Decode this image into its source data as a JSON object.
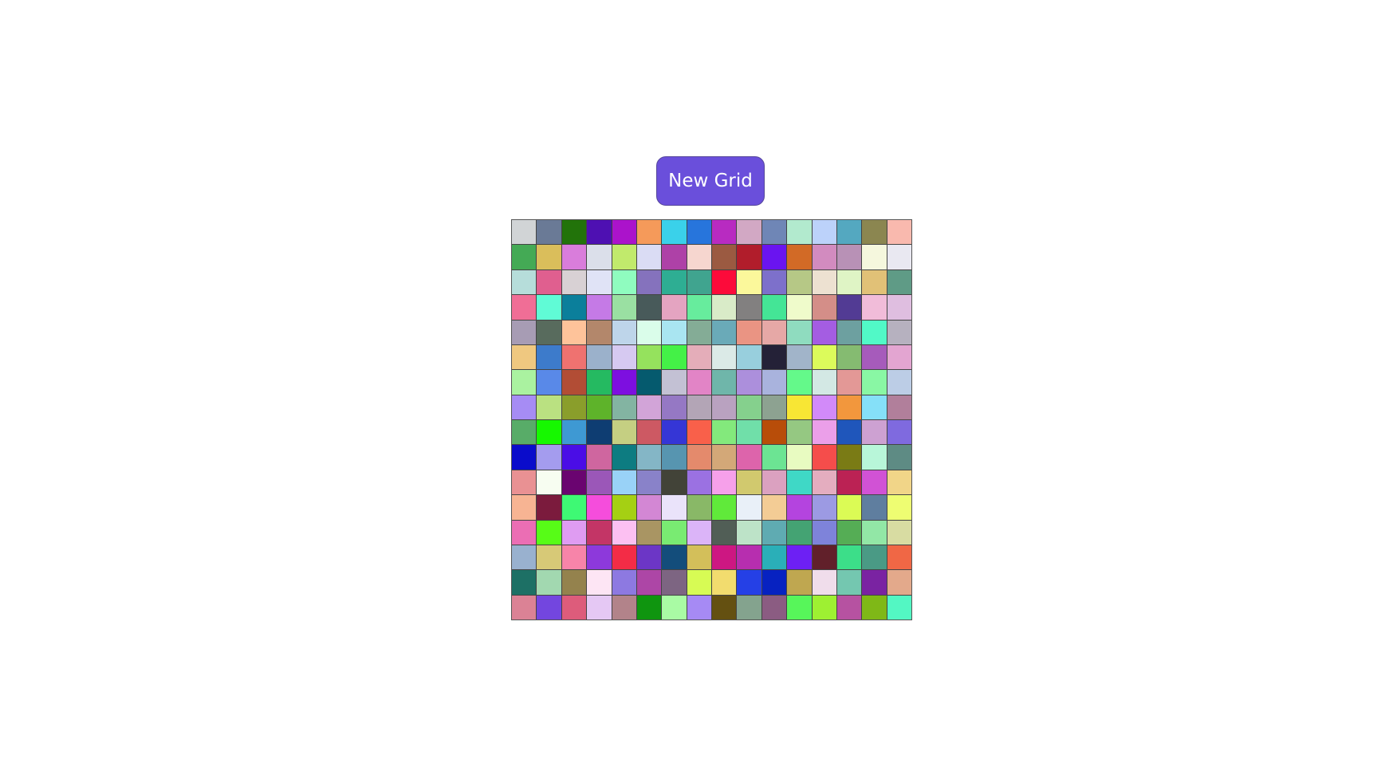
{
  "toolbar": {
    "new_grid_label": "New Grid",
    "button_color": "#6a4fdb"
  },
  "grid": {
    "columns": 16,
    "rows": 16,
    "colors": [
      [
        "#d1d4d6",
        "#6a7a96",
        "#22730a",
        "#4e10b2",
        "#ab13cb",
        "#f59a5a",
        "#3ad1ea",
        "#2775dc",
        "#b82bc1",
        "#d2a8c4",
        "#6f86b6",
        "#b2eace",
        "#bcd2fa",
        "#54a8c0",
        "#8b8650",
        "#f9b9ae"
      ],
      [
        "#44aa55",
        "#dabe5b",
        "#d97ddb",
        "#dbdfea",
        "#c1ea6c",
        "#dadcf4",
        "#ae41a7",
        "#f6d6cf",
        "#9b5a41",
        "#b11d2b",
        "#6a14f0",
        "#d26a26",
        "#d28bbf",
        "#b891b6",
        "#f5f7dd",
        "#e9e8f1"
      ],
      [
        "#b6ddda",
        "#e05f8f",
        "#d8d1d4",
        "#e0e3f6",
        "#8ffcbf",
        "#8572bd",
        "#2eae93",
        "#40a48f",
        "#fc0b3a",
        "#fbf89b",
        "#7d70cb",
        "#b6c886",
        "#ede1d1",
        "#dff4c5",
        "#e1c177",
        "#5f9b86"
      ],
      [
        "#f06e96",
        "#60fbd6",
        "#0b7f9b",
        "#c57ae6",
        "#9ae0a2",
        "#485a5a",
        "#e4a4c1",
        "#67ec9d",
        "#d9ebc8",
        "#828080",
        "#44e596",
        "#effbcb",
        "#d48e88",
        "#523b94",
        "#f1bcd9",
        "#dfbee0"
      ],
      [
        "#a79cb4",
        "#586b5d",
        "#fec39a",
        "#b3876b",
        "#bed5ea",
        "#dafdea",
        "#a9e5f1",
        "#84ac96",
        "#6aaab8",
        "#ea9483",
        "#e6a8a6",
        "#8fdcbf",
        "#a45de2",
        "#6da0a0",
        "#51f9c7",
        "#b6b1bf"
      ],
      [
        "#efc880",
        "#3d7bcb",
        "#ef7270",
        "#9bb1cb",
        "#d6c9f1",
        "#95e25d",
        "#44f147",
        "#e4adb9",
        "#dbeae7",
        "#98cfdd",
        "#242137",
        "#a1b4c9",
        "#dcfb5b",
        "#85bb71",
        "#a65bbb",
        "#e3a5d1"
      ],
      [
        "#aaf2a0",
        "#5989e8",
        "#b24d35",
        "#25ba61",
        "#7d0fe0",
        "#055a6e",
        "#c3c1d4",
        "#e284c6",
        "#6fb6aa",
        "#ac8fdc",
        "#a9b3dd",
        "#64f98a",
        "#d3e8e4",
        "#e39896",
        "#89f7a4",
        "#bccde6"
      ],
      [
        "#a68cf4",
        "#bae181",
        "#8a9e2b",
        "#5eb32a",
        "#83b4a2",
        "#d2a4d8",
        "#9578c4",
        "#b3a5b6",
        "#b9a2c0",
        "#85d08d",
        "#8da291",
        "#f8e634",
        "#d28af9",
        "#f2973d",
        "#85e0f8",
        "#b17f9b"
      ],
      [
        "#58ac68",
        "#16f800",
        "#3e99d3",
        "#0e3d72",
        "#c5cf82",
        "#cd5963",
        "#3536d6",
        "#f9604a",
        "#83e97c",
        "#70dfa9",
        "#b84d09",
        "#95c882",
        "#eb9fe9",
        "#1f56bb",
        "#cda1d2",
        "#7f6adf"
      ],
      [
        "#0a0ccb",
        "#a49cee",
        "#4a0de6",
        "#cf669f",
        "#0d7c81",
        "#84b6c6",
        "#5795b0",
        "#e48a6c",
        "#d3a878",
        "#dd64ab",
        "#6ce493",
        "#e8fbc1",
        "#f54d4b",
        "#7a7b15",
        "#b8f6d9",
        "#5e8b84"
      ],
      [
        "#e99193",
        "#f7fdf1",
        "#6a0470",
        "#9b57b8",
        "#99d2f7",
        "#8982c9",
        "#424338",
        "#9b71e2",
        "#f6a0ea",
        "#d1c96e",
        "#dba1c0",
        "#3fd8c6",
        "#e4adbf",
        "#bb2254",
        "#d152d5",
        "#f1d588"
      ],
      [
        "#f7b493",
        "#7b1b3d",
        "#3ef974",
        "#f54ddc",
        "#a5d013",
        "#d387d4",
        "#eae3fa",
        "#89b867",
        "#60ea3a",
        "#e9f0f8",
        "#f3cc95",
        "#b444df",
        "#9c9ae3",
        "#dbfb55",
        "#5f7e9f",
        "#eefd72"
      ],
      [
        "#eb6eb4",
        "#57fc17",
        "#df9cf2",
        "#c33566",
        "#fcc0f2",
        "#a99563",
        "#79eb72",
        "#dbb4f8",
        "#515e56",
        "#bde3c8",
        "#5fabb2",
        "#44a373",
        "#7e83da",
        "#55ad55",
        "#92e7a6",
        "#d8dca2"
      ],
      [
        "#99b1cf",
        "#d7c977",
        "#f784a9",
        "#8d39db",
        "#f32c46",
        "#6c36c6",
        "#134d7b",
        "#d3bf5a",
        "#cd1782",
        "#b72eaf",
        "#2aafb8",
        "#6d20f4",
        "#61202a",
        "#3cde89",
        "#4a9a85",
        "#f06745"
      ],
      [
        "#1d7065",
        "#a2d8b0",
        "#94824d",
        "#fde5f4",
        "#8d79e1",
        "#ad46a6",
        "#7d6582",
        "#d7fb54",
        "#f2dc6e",
        "#2540e6",
        "#0722c1",
        "#bfa750",
        "#f0ddeb",
        "#74c7b0",
        "#7a23a2",
        "#e3a98b"
      ],
      [
        "#db8295",
        "#7346df",
        "#dd5c7b",
        "#e5c8f4",
        "#b2838a",
        "#0f950f",
        "#a9fba4",
        "#a68af4",
        "#645011",
        "#84a38e",
        "#8b5c82",
        "#57f65a",
        "#9ef032",
        "#b652a1",
        "#7fb817",
        "#53f7c3"
      ]
    ]
  }
}
